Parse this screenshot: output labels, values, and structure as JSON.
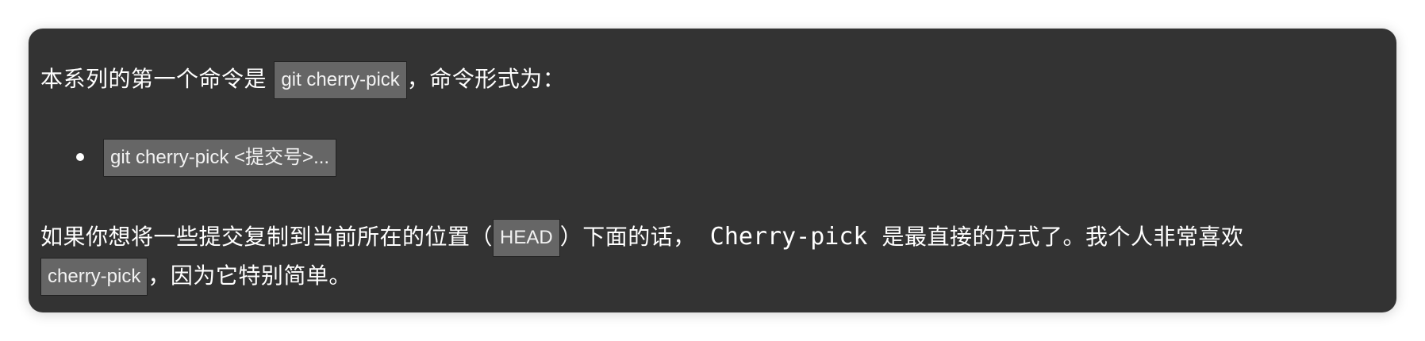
{
  "card": {
    "para1": {
      "prefix": "本系列的第一个命令是 ",
      "code": "git cherry-pick",
      "suffix": "，命令形式为："
    },
    "list": [
      {
        "code": "git cherry-pick <提交号>..."
      }
    ],
    "para2": {
      "line1_prefix": "如果你想将一些提交复制到当前所在的位置（",
      "line1_code": "HEAD",
      "line1_middle": "）下面的话，",
      "line1_mono": " Cherry-pick ",
      "line1_suffix": "是最直接的方式了。我个人非常喜欢",
      "line2_code": "cherry-pick",
      "line2_suffix": "，因为它特别简单。"
    }
  }
}
